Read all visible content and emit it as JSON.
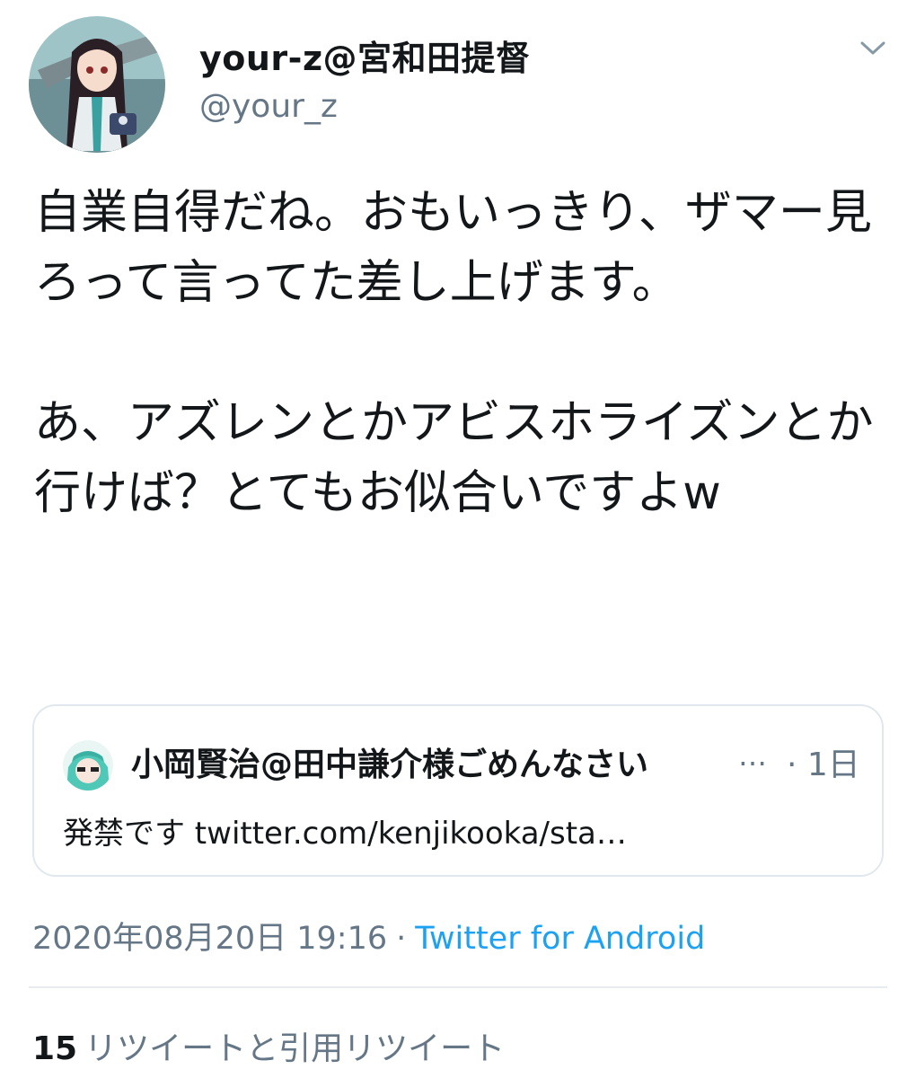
{
  "author": {
    "display_name": "your-z@宮和田提督",
    "handle": "@your_z",
    "avatar_icon": "anime-character-avatar-icon",
    "menu_icon": "chevron-down-icon"
  },
  "tweet": {
    "text": "自業自得だね。おもいっきり、ザマー見ろって言ってた差し上げます。\n\nあ、アズレンとかアビスホライズンとか行けば？とてもお似合いですよw"
  },
  "quoted_tweet": {
    "display_name": "小岡賢治@田中謙介様ごめんなさい",
    "ellipsis": "…",
    "time": "· 1日",
    "text": "発禁です twitter.com/kenjikooka/sta…",
    "avatar_icon": "anime-character-avatar-icon"
  },
  "meta": {
    "timestamp": "2020年08月20日 19:16",
    "separator": "·",
    "source": "Twitter for Android"
  },
  "stats": {
    "retweets_count": "15",
    "retweets_label": "リツイートと引用リツイート"
  },
  "colors": {
    "text": "#14171a",
    "secondary": "#657786",
    "link": "#1da1f2",
    "border": "#e1e8ed"
  }
}
